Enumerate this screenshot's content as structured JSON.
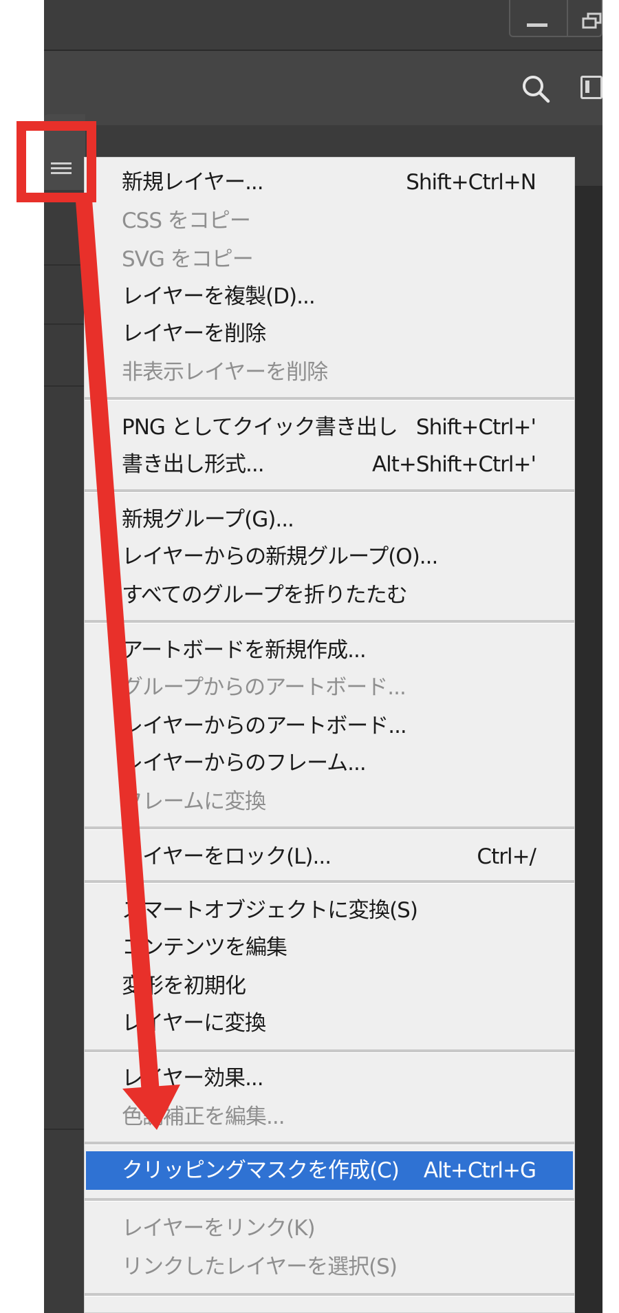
{
  "window": {
    "minimize_icon": "minimize-icon",
    "restore_icon": "restore-icon"
  },
  "toolbar": {
    "search_icon": "search-icon",
    "panel_icon": "panel-toggle-icon"
  },
  "panel": {
    "menu_icon": "hamburger-menu-icon"
  },
  "menu": {
    "items": [
      {
        "label": "新規レイヤー...",
        "shortcut": "Shift+Ctrl+N",
        "enabled": true
      },
      {
        "label": "CSS をコピー",
        "shortcut": "",
        "enabled": false
      },
      {
        "label": "SVG をコピー",
        "shortcut": "",
        "enabled": false
      },
      {
        "label": "レイヤーを複製(D)...",
        "shortcut": "",
        "enabled": true
      },
      {
        "label": "レイヤーを削除",
        "shortcut": "",
        "enabled": true
      },
      {
        "label": "非表示レイヤーを削除",
        "shortcut": "",
        "enabled": false
      },
      {
        "label": "PNG としてクイック書き出し",
        "shortcut": "Shift+Ctrl+'",
        "enabled": true
      },
      {
        "label": "書き出し形式...",
        "shortcut": "Alt+Shift+Ctrl+'",
        "enabled": true
      },
      {
        "label": "新規グループ(G)...",
        "shortcut": "",
        "enabled": true
      },
      {
        "label": "レイヤーからの新規グループ(O)...",
        "shortcut": "",
        "enabled": true
      },
      {
        "label": "すべてのグループを折りたたむ",
        "shortcut": "",
        "enabled": true
      },
      {
        "label": "アートボードを新規作成...",
        "shortcut": "",
        "enabled": true
      },
      {
        "label": "グループからのアートボード...",
        "shortcut": "",
        "enabled": false
      },
      {
        "label": "レイヤーからのアートボード...",
        "shortcut": "",
        "enabled": true
      },
      {
        "label": "レイヤーからのフレーム...",
        "shortcut": "",
        "enabled": true
      },
      {
        "label": "フレームに変換",
        "shortcut": "",
        "enabled": false
      },
      {
        "label": "レイヤーをロック(L)...",
        "shortcut": "Ctrl+/",
        "enabled": true
      },
      {
        "label": "スマートオブジェクトに変換(S)",
        "shortcut": "",
        "enabled": true
      },
      {
        "label": "コンテンツを編集",
        "shortcut": "",
        "enabled": true
      },
      {
        "label": "変形を初期化",
        "shortcut": "",
        "enabled": true
      },
      {
        "label": "レイヤーに変換",
        "shortcut": "",
        "enabled": true
      },
      {
        "label": "レイヤー効果...",
        "shortcut": "",
        "enabled": true
      },
      {
        "label": "色調補正を編集...",
        "shortcut": "",
        "enabled": false
      },
      {
        "label": "クリッピングマスクを作成(C)",
        "shortcut": "Alt+Ctrl+G",
        "enabled": true,
        "highlighted": true
      },
      {
        "label": "レイヤーをリンク(K)",
        "shortcut": "",
        "enabled": false
      },
      {
        "label": "リンクしたレイヤーを選択(S)",
        "shortcut": "",
        "enabled": false
      }
    ]
  },
  "annotation": {
    "color": "#e8302a",
    "highlight_color": "#2f72d3"
  }
}
